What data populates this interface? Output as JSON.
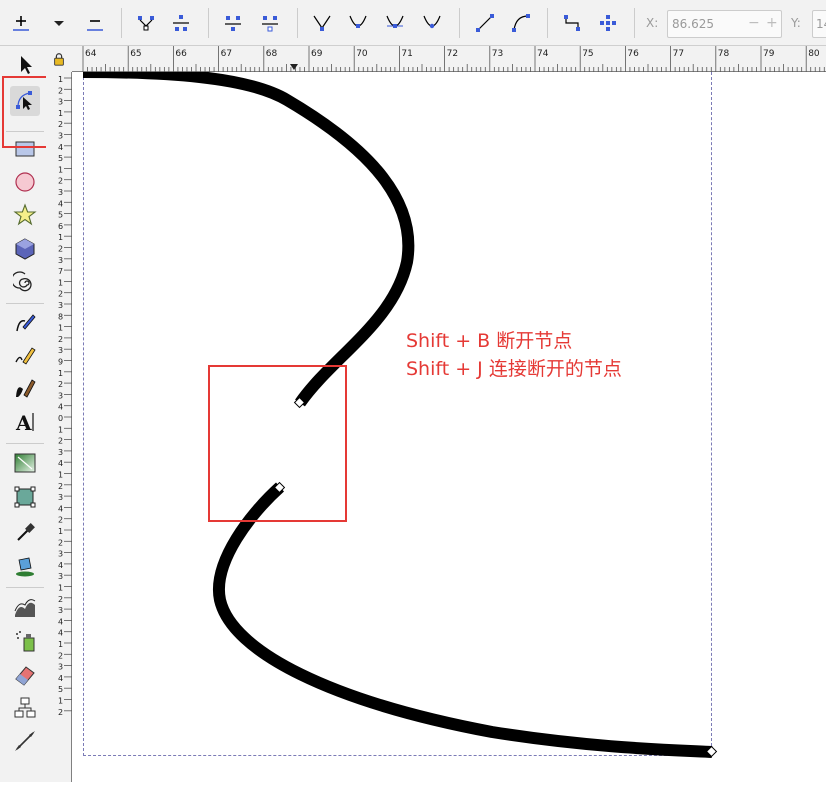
{
  "toolbar": {
    "buttons": [
      {
        "name": "insert-node-button",
        "icon": "insert-node-icon"
      },
      {
        "name": "insert-dropdown-button",
        "icon": "chevron-down-icon"
      },
      {
        "name": "delete-node-button",
        "icon": "delete-node-icon"
      },
      {
        "name": "join-nodes-button",
        "icon": "join-nodes-icon"
      },
      {
        "name": "break-path-button",
        "icon": "break-path-icon"
      },
      {
        "name": "join-segment-button",
        "icon": "join-segment-icon"
      },
      {
        "name": "delete-segment-button",
        "icon": "delete-segment-icon"
      },
      {
        "name": "node-cusp-button",
        "icon": "node-cusp-icon"
      },
      {
        "name": "node-smooth-button",
        "icon": "node-smooth-icon"
      },
      {
        "name": "node-symmetric-button",
        "icon": "node-symmetric-icon"
      },
      {
        "name": "node-auto-button",
        "icon": "node-auto-icon"
      },
      {
        "name": "segment-line-button",
        "icon": "segment-line-icon"
      },
      {
        "name": "segment-curve-button",
        "icon": "segment-curve-icon"
      },
      {
        "name": "object-to-path-button",
        "icon": "object-to-path-icon"
      },
      {
        "name": "stroke-to-path-button",
        "icon": "stroke-to-path-icon"
      }
    ],
    "x_label": "X:",
    "x_value": "86.625",
    "y_label": "Y:",
    "y_value": "14"
  },
  "ruler": {
    "h_labels": [
      "64",
      "65",
      "66",
      "67",
      "68",
      "69",
      "70",
      "71",
      "72",
      "73",
      "74",
      "75",
      "76",
      "77",
      "78",
      "79",
      "80"
    ],
    "v_labels": [
      "1",
      "2",
      "3",
      "1",
      "2",
      "3",
      "4",
      "5",
      "1",
      "2",
      "3",
      "4",
      "5",
      "6",
      "1",
      "2",
      "3",
      "7",
      "1",
      "2",
      "3",
      "8",
      "1",
      "2",
      "3",
      "9",
      "1",
      "2",
      "3",
      "4",
      "0",
      "1",
      "2",
      "3",
      "4",
      "1",
      "2",
      "3",
      "4",
      "2",
      "1",
      "2",
      "3",
      "4",
      "3",
      "1",
      "2",
      "3",
      "4",
      "4",
      "1",
      "2",
      "3",
      "4",
      "5",
      "1",
      "2"
    ]
  },
  "tools": [
    {
      "name": "selector-tool",
      "icon": "arrow-pointer-icon"
    },
    {
      "name": "node-tool",
      "icon": "node-editor-icon",
      "active": true
    },
    {
      "name": "rectangle-tool",
      "icon": "rectangle-icon"
    },
    {
      "name": "ellipse-tool",
      "icon": "circle-icon"
    },
    {
      "name": "star-tool",
      "icon": "star-icon"
    },
    {
      "name": "3dbox-tool",
      "icon": "cube-icon"
    },
    {
      "name": "spiral-tool",
      "icon": "spiral-icon"
    },
    {
      "name": "pen-tool",
      "icon": "pen-icon"
    },
    {
      "name": "pencil-tool",
      "icon": "pencil-icon"
    },
    {
      "name": "calligraphy-tool",
      "icon": "calligraphy-icon"
    },
    {
      "name": "text-tool",
      "icon": "text-icon"
    },
    {
      "name": "gradient-tool",
      "icon": "gradient-icon"
    },
    {
      "name": "mesh-tool",
      "icon": "mesh-icon"
    },
    {
      "name": "dropper-tool",
      "icon": "dropper-icon"
    },
    {
      "name": "paint-bucket-tool",
      "icon": "paint-bucket-icon"
    },
    {
      "name": "tweak-tool",
      "icon": "tweak-icon"
    },
    {
      "name": "spray-tool",
      "icon": "spray-icon"
    },
    {
      "name": "eraser-tool",
      "icon": "eraser-icon"
    },
    {
      "name": "connector-tool",
      "icon": "connector-icon"
    },
    {
      "name": "measure-tool",
      "icon": "measure-icon"
    }
  ],
  "annotation": {
    "line1": "Shift + B 断开节点",
    "line2": "Shift + J 连接断开的节点",
    "color": "#e53935"
  },
  "colors": {
    "accent": "#e53935",
    "node_blue": "#3a5bd8",
    "path": "#000000"
  }
}
